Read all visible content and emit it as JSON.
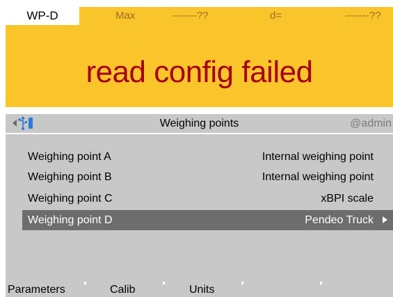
{
  "status": {
    "scale_name": "WP-D",
    "max_label": "Max",
    "max_value": "-------??",
    "d_label": "d=",
    "d_value": "-------??",
    "message": "read config failed"
  },
  "titlebar": {
    "title": "Weighing points",
    "user": "@admin",
    "icons": [
      "back-arrow-icon",
      "usb-icon"
    ]
  },
  "list": {
    "rows": [
      {
        "name": "Weighing point A",
        "value": "Internal weighing point",
        "selected": false
      },
      {
        "name": "Weighing point B",
        "value": "Internal weighing point",
        "selected": false
      },
      {
        "name": "Weighing point C",
        "value": "xBPI scale",
        "selected": false
      },
      {
        "name": "Weighing point D",
        "value": "Pendeo Truck",
        "selected": true
      }
    ]
  },
  "softkeys": {
    "keys": [
      "Parameters",
      "Calib",
      "Units",
      "",
      "",
      ""
    ]
  },
  "colors": {
    "status_bg": "#f9c52a",
    "error_text": "#a50016",
    "panel_bg": "#c8c8c8",
    "selected_bg": "#6d6d6d",
    "label_text": "#9c6e2a",
    "usb_icon": "#2a7bd6"
  }
}
